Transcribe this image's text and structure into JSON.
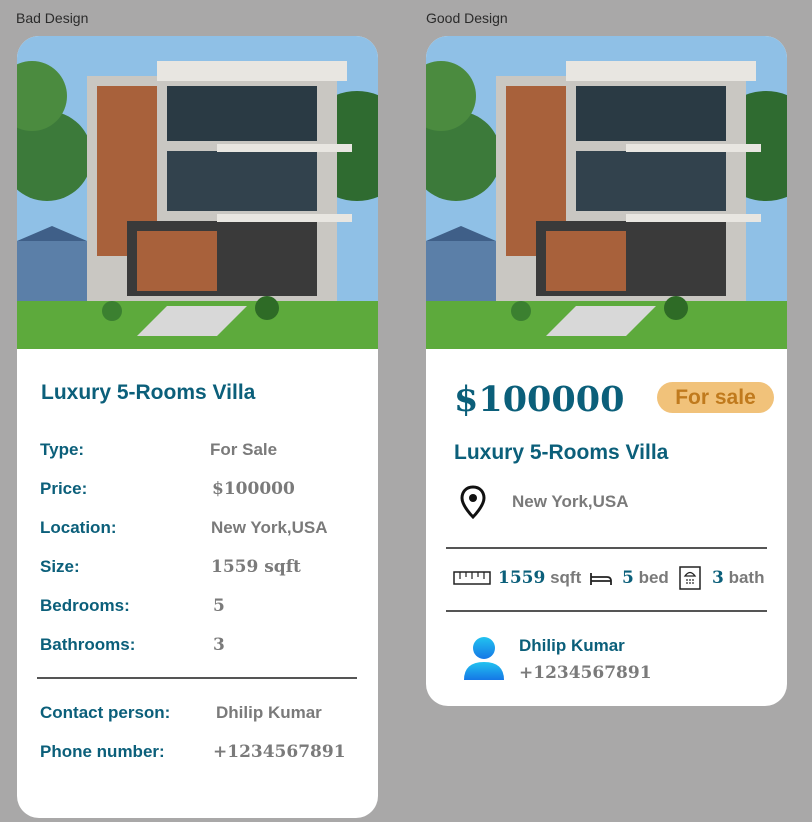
{
  "labels": {
    "bad": "Bad Design",
    "good": "Good Design"
  },
  "listing": {
    "title": "Luxury 5-Rooms Villa",
    "type": "For Sale",
    "price": "$100000",
    "location": "New York,USA",
    "size": "1559 sqft",
    "bedrooms": "5",
    "bathrooms": "3",
    "contact_name": "Dhilip Kumar",
    "phone": "+1234567891"
  },
  "bad_card": {
    "rows": [
      {
        "label": "Type:",
        "value": "For Sale"
      },
      {
        "label": "Price:",
        "value": "$100000"
      },
      {
        "label": "Location:",
        "value": "New York,USA"
      },
      {
        "label": "Size:",
        "value": "1559 sqft"
      },
      {
        "label": "Bedrooms:",
        "value": "5"
      },
      {
        "label": "Bathrooms:",
        "value": "3"
      }
    ],
    "contact_rows": [
      {
        "label": "Contact person:",
        "value": "Dhilip Kumar"
      },
      {
        "label": "Phone number:",
        "value": "+1234567891"
      }
    ]
  },
  "good_card": {
    "badge": "For sale",
    "size_num": "1559",
    "size_unit": "sqft",
    "bed_num": "5",
    "bed_unit": "bed",
    "bath_num": "3",
    "bath_unit": "bath"
  },
  "colors": {
    "accent": "#0b5f7a",
    "muted": "#7a7a7a",
    "badge_bg": "#f1c27a",
    "badge_text": "#c07a1d",
    "background": "#a9a8a8"
  },
  "icons": [
    "location-pin-icon",
    "ruler-icon",
    "bed-icon",
    "shower-icon",
    "user-avatar-icon"
  ]
}
